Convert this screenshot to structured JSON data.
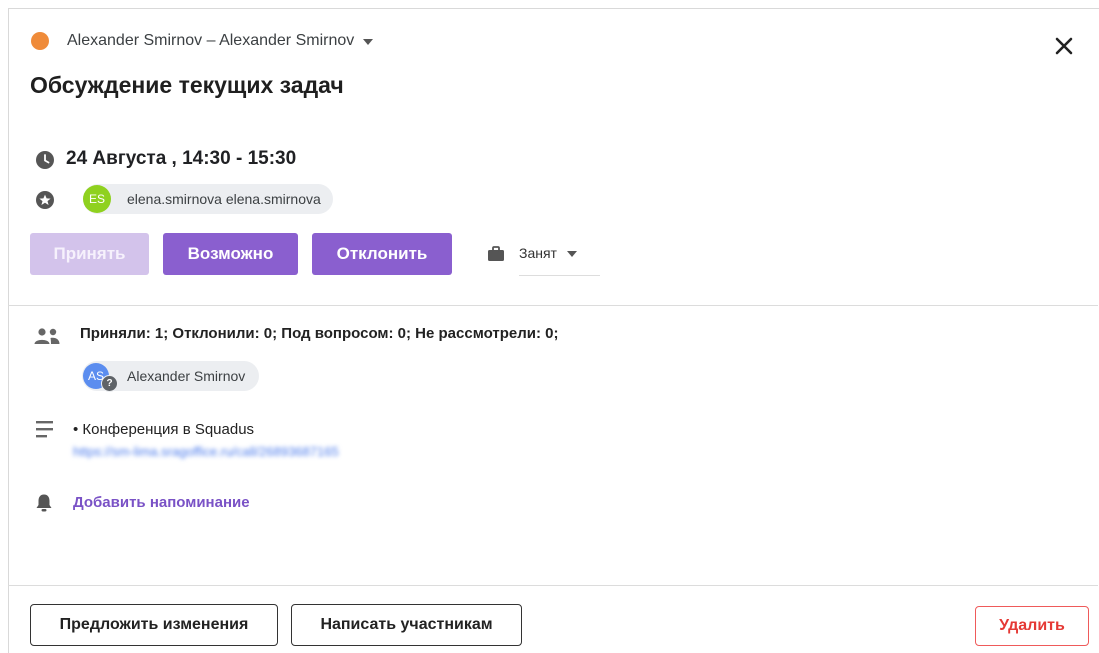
{
  "header": {
    "calendar_owner": "Alexander Smirnov – Alexander Smirnov",
    "calendar_color": "#ef8b3a",
    "close_icon": "close-icon"
  },
  "event": {
    "title": "Обсуждение текущих задач",
    "datetime": "24 Августа , 14:30 - 15:30",
    "organizer": {
      "initials": "ES",
      "label": "elena.smirnova elena.smirnova",
      "avatar_color": "#8fd11f"
    }
  },
  "rsvp": {
    "accept_label": "Принять",
    "maybe_label": "Возможно",
    "decline_label": "Отклонить",
    "accept_color": "#d3c3eb",
    "active_color": "#8a5fcf",
    "status_value": "Занят"
  },
  "attendees": {
    "summary": "Приняли: 1; Отклонили: 0; Под вопросом: 0; Не рассмотрели: 0;",
    "list": [
      {
        "initials": "AS",
        "name": "Alexander Smirnov",
        "status_badge": "?",
        "avatar_color": "#5b8def"
      }
    ]
  },
  "description": {
    "text": "• Конференция в Squadus",
    "link": "https://sm-lima.sragoffice.ru/call/26893687165"
  },
  "reminder": {
    "add_label": "Добавить напоминание"
  },
  "footer": {
    "propose_label": "Предложить изменения",
    "message_label": "Написать участникам",
    "delete_label": "Удалить"
  }
}
